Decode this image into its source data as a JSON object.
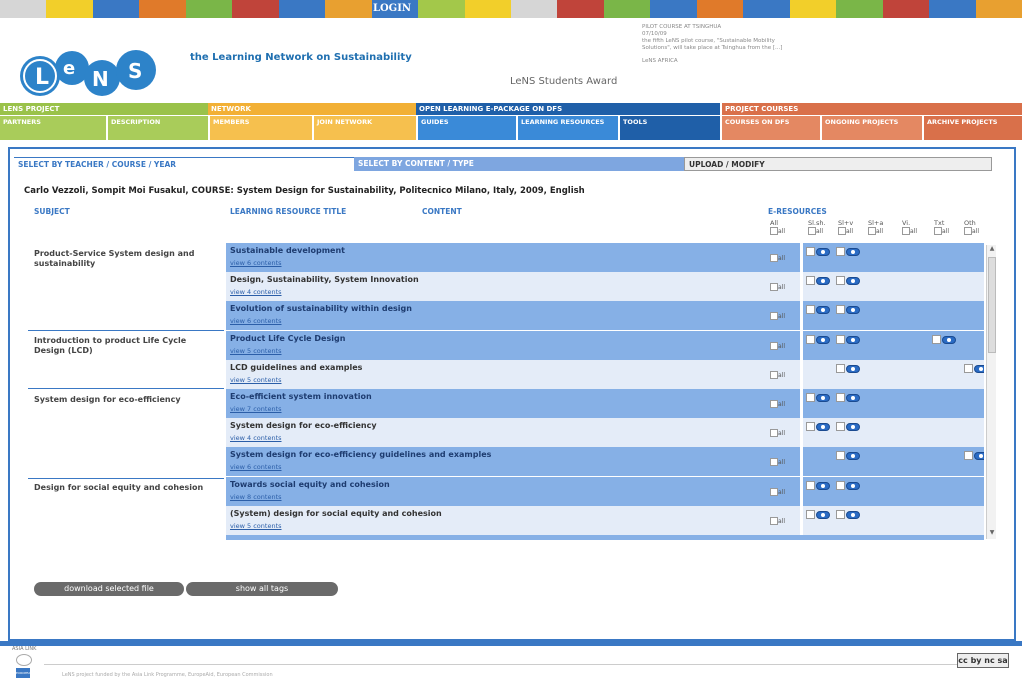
{
  "colors": {
    "accent_blue": "#3a78c4",
    "strip": [
      "#d6d6d6",
      "#f2cf2a",
      "#3a78c4",
      "#e07a2a",
      "#7ab648",
      "#c0443a",
      "#3a78c4",
      "#e8a030",
      "#3a78c4",
      "#a3c84a",
      "#f2cf2a",
      "#d6d6d6",
      "#c0443a",
      "#7ab648",
      "#3a78c4",
      "#e07a2a",
      "#3a78c4",
      "#f2cf2a",
      "#7ab648",
      "#c0443a",
      "#3a78c4",
      "#e8a030"
    ]
  },
  "header": {
    "login": "LOGIN",
    "tagline": "the Learning Network on Sustainability",
    "award": "LeNS Students Award",
    "news": {
      "title": "PILOT COURSE AT TSINGHUA",
      "date": "07/10/09",
      "body": "the fifth LeNS pilot course, \"Sustainable Mobility Solutions\", will take place at Tsinghua from the [...]",
      "africa": "LeNS AFRICA"
    }
  },
  "nav": {
    "lens_project": "LENS PROJECT",
    "network": "NETWORK",
    "open_learning": "OPEN LEARNING E-PACKAGE ON DFS",
    "project_courses": "PROJECT COURSES",
    "partners": "PARTNERS",
    "description": "DESCRIPTION",
    "members": "MEMBERS",
    "join_network": "JOIN NETWORK",
    "guides": "GUIDES",
    "learning_resources": "LEARNING RESOURCES",
    "tools": "TOOLS",
    "courses_on_dfs": "COURSES ON DFS",
    "ongoing_projects": "ONGOING PROJECTS",
    "archive_projects": "ARCHIVE PROJECTS"
  },
  "tabs": {
    "teacher": "SELECT BY TEACHER / COURSE / YEAR",
    "content": "SELECT BY CONTENT / TYPE",
    "upload": "UPLOAD / MODIFY"
  },
  "course_line": "Carlo Vezzoli, Sompit Moi Fusakul, COURSE: System Design for Sustainability, Politecnico Milano, Italy, 2009, English",
  "columns": {
    "subject": "SUBJECT",
    "title": "LEARNING RESOURCE TITLE",
    "content": "CONTENT",
    "eresources": "E-RESOURCES",
    "all": "All",
    "slsh": "Sl.sh.",
    "slv": "Sl+v",
    "sla": "Sl+a",
    "vi": "Vi.",
    "txt": "Txt",
    "oth": "Oth",
    "all_small": "all"
  },
  "subjects": [
    "Product-Service System design and sustainability",
    "Introduction to product Life Cycle Design (LCD)",
    "System design for eco-efficiency",
    "Design for social equity and cohesion"
  ],
  "rows": [
    {
      "title": "Sustainable development",
      "link": "view 6 contents"
    },
    {
      "title": "Design, Sustainability, System Innovation",
      "link": "view 4 contents"
    },
    {
      "title": "Evolution of sustainability within design",
      "link": "view 6 contents"
    },
    {
      "title": "Product Life Cycle Design",
      "link": "view 5 contents"
    },
    {
      "title": "LCD guidelines and examples",
      "link": "view 5 contents"
    },
    {
      "title": "Eco-efficient system innovation",
      "link": "view 7 contents"
    },
    {
      "title": "System design for eco-efficiency",
      "link": "view 4 contents"
    },
    {
      "title": "System design for eco-efficiency guidelines and examples",
      "link": "view 6 contents"
    },
    {
      "title": "Towards social equity and cohesion",
      "link": "view 8 contents"
    },
    {
      "title": "(System) design for social equity and cohesion",
      "link": "view 5 contents"
    }
  ],
  "buttons": {
    "download": "download selected file",
    "show_tags": "show all tags"
  },
  "footer": {
    "asia": "ASIA LINK",
    "europe": "EUROPEAID",
    "funding": "LeNS project funded by the Asia Link Programme, EuropeAid, European Commission",
    "cc": "cc by nc sa"
  }
}
